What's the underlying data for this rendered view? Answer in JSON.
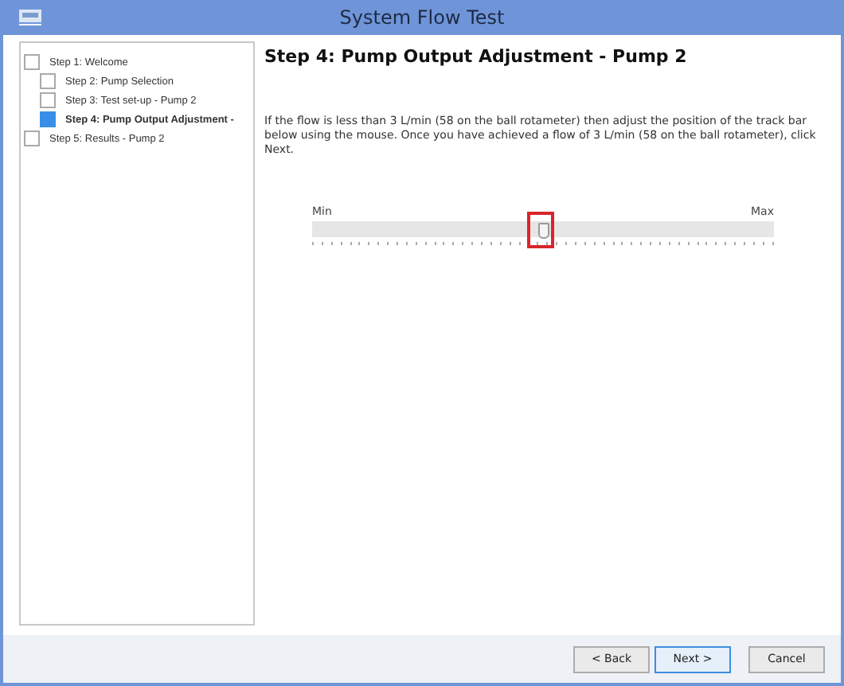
{
  "window": {
    "title": "System Flow Test"
  },
  "steps": [
    {
      "label": "Step 1: Welcome",
      "selected": false,
      "children": [
        {
          "label": "Step 2: Pump Selection",
          "selected": false
        },
        {
          "label": "Step 3: Test set-up - Pump 2",
          "selected": false
        },
        {
          "label": "Step 4: Pump Output Adjustment -",
          "selected": true
        }
      ]
    },
    {
      "label": "Step 5: Results - Pump 2",
      "selected": false
    }
  ],
  "page": {
    "heading": "Step 4: Pump Output Adjustment - Pump 2",
    "instructions": "If the flow is less than 3 L/min (58 on the ball rotameter) then adjust the position of the track bar below using the mouse. Once you have achieved a flow of 3 L/min (58 on the ball rotameter), click Next."
  },
  "slider": {
    "min_label": "Min",
    "max_label": "Max",
    "level": 0.5,
    "highlighted": true
  },
  "buttons": [
    {
      "label": "< Back",
      "selected": false
    },
    {
      "label": "Next >",
      "selected": true
    },
    {
      "label": "Cancel",
      "selected": false
    }
  ]
}
